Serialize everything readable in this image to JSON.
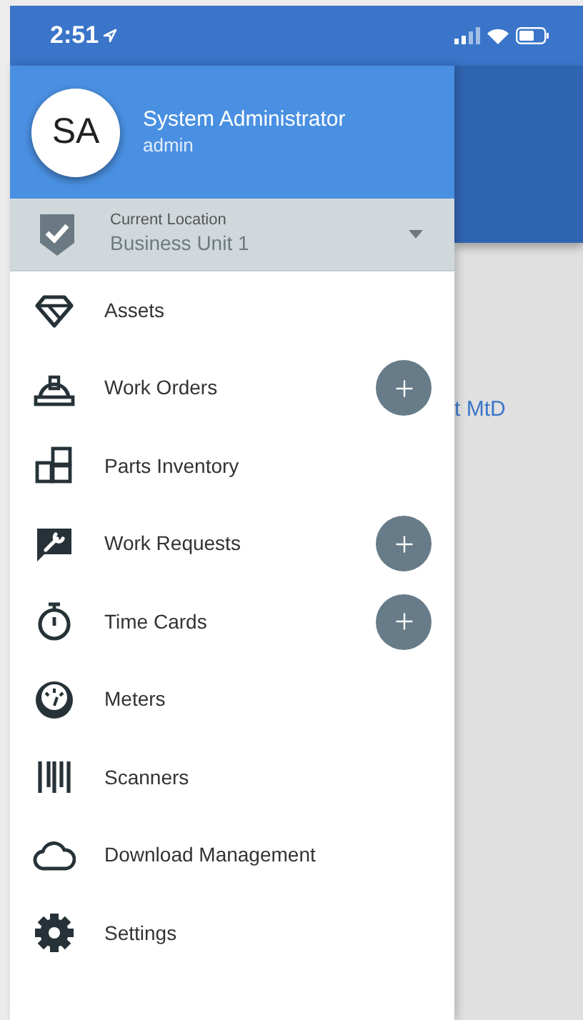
{
  "status_bar": {
    "time": "2:51"
  },
  "drawer": {
    "user": {
      "initials": "SA",
      "name": "System Administrator",
      "username": "admin"
    },
    "location": {
      "label": "Current Location",
      "value": "Business Unit 1"
    },
    "items": [
      {
        "label": "Assets",
        "add_button": false
      },
      {
        "label": "Work Orders",
        "add_button": true
      },
      {
        "label": "Parts Inventory",
        "add_button": false
      },
      {
        "label": "Work Requests",
        "add_button": true
      },
      {
        "label": "Time Cards",
        "add_button": true
      },
      {
        "label": "Meters",
        "add_button": false
      },
      {
        "label": "Scanners",
        "add_button": false
      },
      {
        "label": "Download Management",
        "add_button": false
      },
      {
        "label": "Settings",
        "add_button": false
      }
    ]
  },
  "background": {
    "link_fragment": "t MtD"
  }
}
